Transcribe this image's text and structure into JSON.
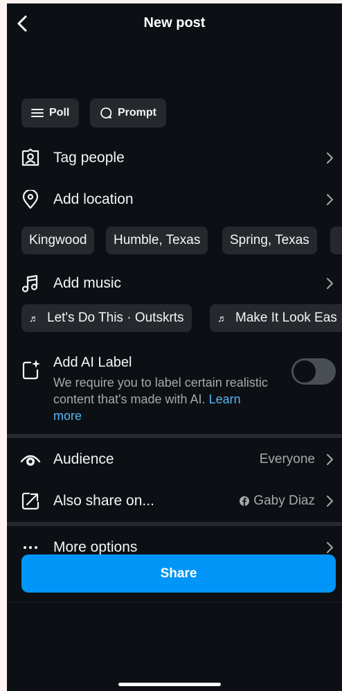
{
  "header": {
    "title": "New post",
    "back_icon": "chevron-left-icon"
  },
  "chips": [
    {
      "label": "Poll",
      "icon": "list-icon"
    },
    {
      "label": "Prompt",
      "icon": "speech-bubble-icon"
    }
  ],
  "rows": {
    "tag_people": {
      "label": "Tag people",
      "icon": "tag-person-icon"
    },
    "add_location": {
      "label": "Add location",
      "icon": "location-pin-icon"
    },
    "add_music": {
      "label": "Add music",
      "icon": "music-note-icon"
    },
    "audience": {
      "label": "Audience",
      "value": "Everyone",
      "icon": "eye-icon"
    },
    "also_share": {
      "label": "Also share on...",
      "value": "Gaby Diaz",
      "icon": "share-arrow-icon",
      "value_icon": "facebook-icon"
    },
    "more_options": {
      "label": "More options",
      "icon": "ellipsis-icon"
    }
  },
  "location_suggestions": [
    "Kingwood",
    "Humble, Texas",
    "Spring, Texas"
  ],
  "music_suggestions": [
    "Let's Do This · Outskrts",
    "Make It Look Eas"
  ],
  "ai_label": {
    "title": "Add AI Label",
    "description": "We require you to label certain realistic content that's made with AI.",
    "link": "Learn more",
    "toggle_on": false,
    "icon": "ai-sparkle-icon"
  },
  "share_button": {
    "label": "Share"
  },
  "colors": {
    "background": "#0c1014",
    "surface": "#25292e",
    "primary": "#0095f6",
    "link": "#58b4f0",
    "secondary_text": "#a8a8a8"
  }
}
